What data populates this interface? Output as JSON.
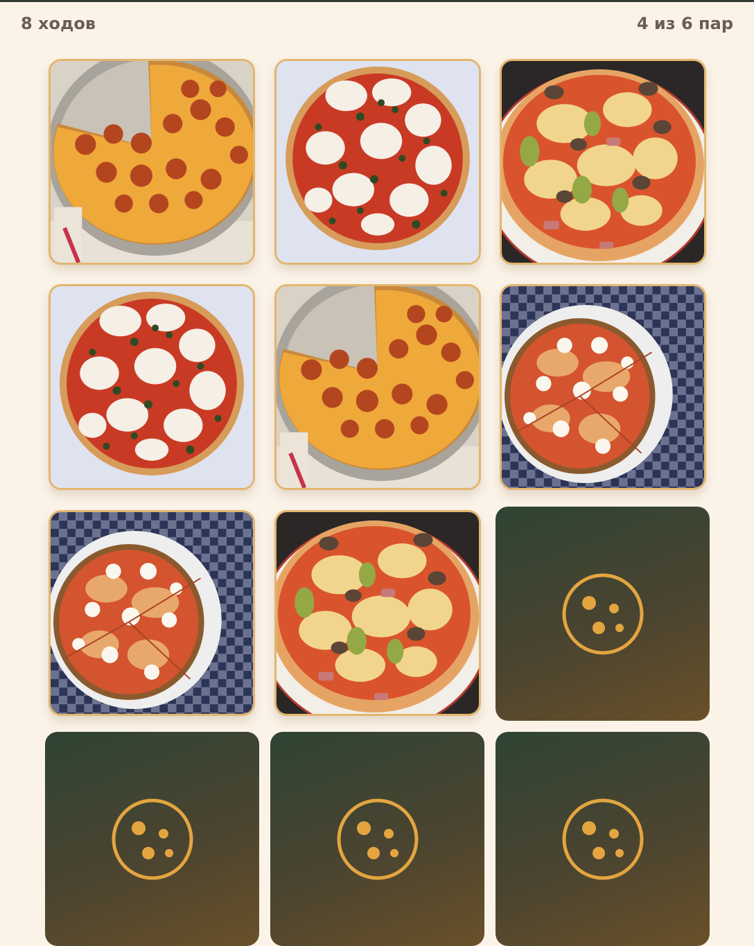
{
  "header": {
    "moves": "8 ходов",
    "pairs": "4 из 6 пар"
  },
  "colors": {
    "background": "#fbf3e8",
    "card_border": "#e2b56f",
    "card_back": "#3b4530",
    "emblem": "#e4a540",
    "text": "#6b5d55"
  },
  "cards": [
    {
      "state": "flipped",
      "image": "pepperoni-pizza-image"
    },
    {
      "state": "flipped",
      "image": "margherita-pizza-image"
    },
    {
      "state": "flipped",
      "image": "capricciosa-pizza-image"
    },
    {
      "state": "flipped",
      "image": "margherita-pizza-image"
    },
    {
      "state": "flipped",
      "image": "pepperoni-pizza-image"
    },
    {
      "state": "flipped",
      "image": "ricotta-pizza-image"
    },
    {
      "state": "flipped",
      "image": "ricotta-pizza-image"
    },
    {
      "state": "flipped",
      "image": "capricciosa-pizza-image"
    },
    {
      "state": "face-down",
      "icon": "cookie-icon"
    },
    {
      "state": "face-down",
      "icon": "cookie-icon"
    },
    {
      "state": "face-down",
      "icon": "cookie-icon"
    },
    {
      "state": "face-down",
      "icon": "cookie-icon"
    }
  ]
}
